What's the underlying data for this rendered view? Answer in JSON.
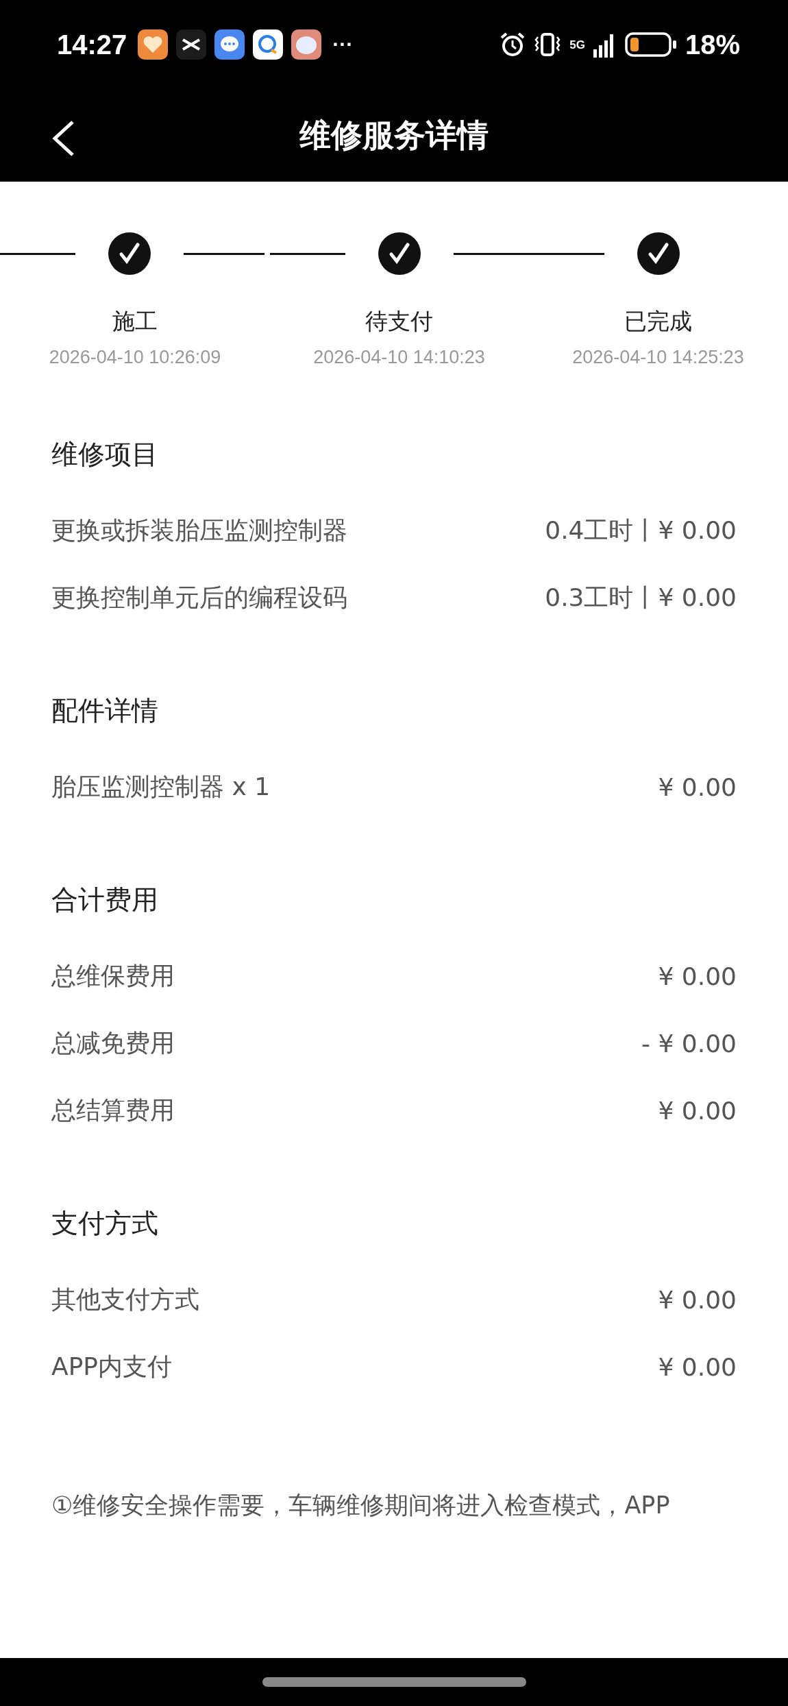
{
  "status_bar": {
    "time": "14:27",
    "more": "···",
    "network": "5G",
    "battery": "18%"
  },
  "nav": {
    "title": "维修服务详情"
  },
  "steps": [
    {
      "label": "施工",
      "time": "2026-04-10 10:26:09",
      "done": true
    },
    {
      "label": "待支付",
      "time": "2026-04-10 14:10:23",
      "done": true
    },
    {
      "label": "已完成",
      "time": "2026-04-10 14:25:23",
      "done": true
    }
  ],
  "sections": [
    {
      "title": "维修项目",
      "rows": [
        {
          "label": "更换或拆装胎压监测控制器",
          "value": "0.4工时丨¥ 0.00"
        },
        {
          "label": "更换控制单元后的编程设码",
          "value": "0.3工时丨¥ 0.00"
        }
      ]
    },
    {
      "title": "配件详情",
      "rows": [
        {
          "label": "胎压监测控制器 x 1",
          "value": "¥ 0.00"
        }
      ]
    },
    {
      "title": "合计费用",
      "rows": [
        {
          "label": "总维保费用",
          "value": "¥ 0.00"
        },
        {
          "label": "总减免费用",
          "value": "- ¥ 0.00"
        },
        {
          "label": "总结算费用",
          "value": "¥ 0.00"
        }
      ]
    },
    {
      "title": "支付方式",
      "rows": [
        {
          "label": "其他支付方式",
          "value": "¥ 0.00"
        },
        {
          "label": "APP内支付",
          "value": "¥ 0.00"
        }
      ]
    }
  ],
  "footnote": "①维修安全操作需要，车辆维修期间将进入检查模式，APP"
}
